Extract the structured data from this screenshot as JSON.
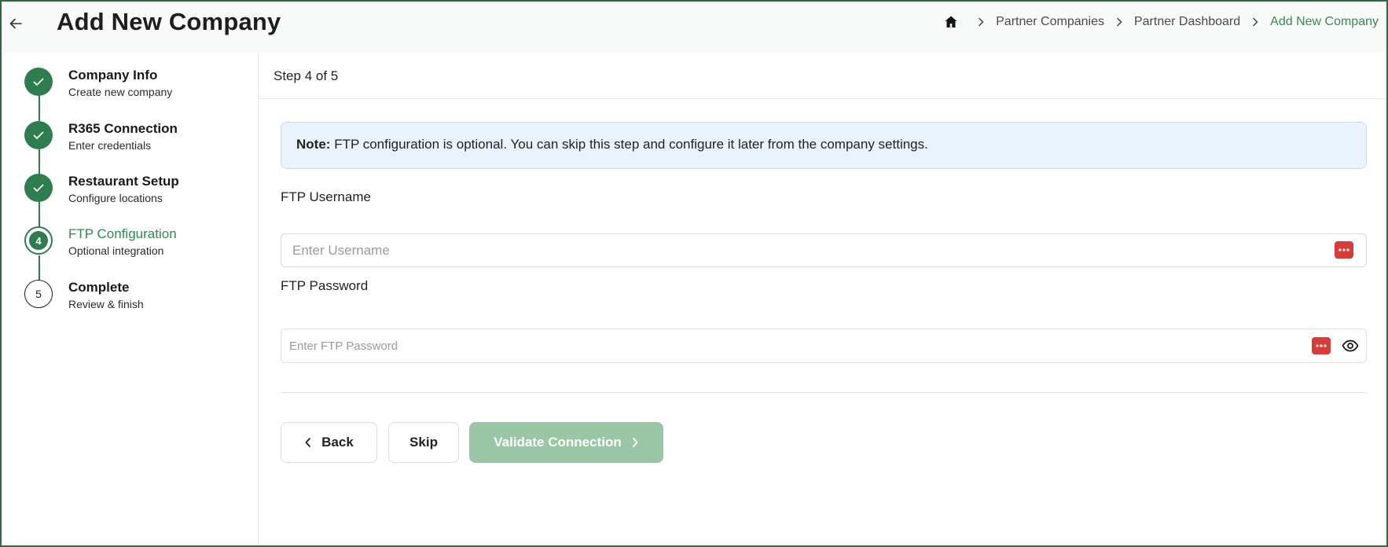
{
  "header": {
    "title": "Add New Company",
    "back_icon": "arrow-left-icon",
    "breadcrumb": {
      "home_icon": "home-icon",
      "items": [
        "Partner Companies",
        "Partner Dashboard"
      ],
      "current": "Add New Company"
    }
  },
  "sidebar": {
    "steps": [
      {
        "title": "Company Info",
        "subtitle": "Create new company",
        "status": "done"
      },
      {
        "title": "R365 Connection",
        "subtitle": "Enter credentials",
        "status": "done"
      },
      {
        "title": "Restaurant Setup",
        "subtitle": "Configure locations",
        "status": "done"
      },
      {
        "title": "FTP Configuration",
        "subtitle": "Optional integration",
        "status": "active",
        "number": "4"
      },
      {
        "title": "Complete",
        "subtitle": "Review & finish",
        "status": "pending",
        "number": "5"
      }
    ]
  },
  "main": {
    "step_indicator": "Step 4 of 5",
    "note": {
      "label": "Note:",
      "text": "FTP configuration is optional. You can skip this step and configure it later from the company settings."
    },
    "fields": {
      "username": {
        "label": "FTP Username",
        "placeholder": "Enter Username",
        "value": ""
      },
      "password": {
        "label": "FTP Password",
        "placeholder": "Enter FTP Password",
        "value": ""
      }
    },
    "buttons": {
      "back": "Back",
      "skip": "Skip",
      "validate": "Validate Connection"
    }
  },
  "colors": {
    "accent": "#2e7d4f",
    "accent_light": "#9ac6a6",
    "breadcrumb_current": "#3a8a4f",
    "note_bg": "#eaf3fd",
    "password_manager": "#d93a3a",
    "frame_border": "#2e6b3a"
  }
}
